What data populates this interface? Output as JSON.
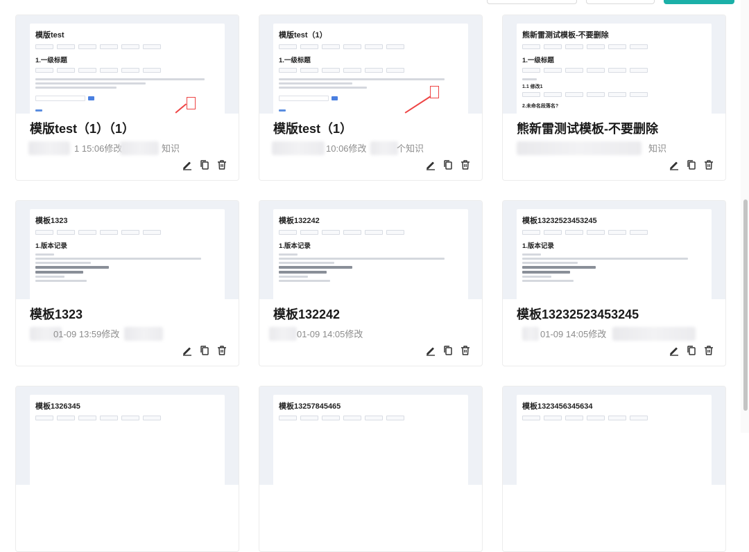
{
  "cards": [
    {
      "title": "模版test（1）（1）",
      "modified": "1 15:06修改",
      "kb": "知识",
      "preview": {
        "doc_title": "模版test",
        "heading": "1.一级标题",
        "subheading": ""
      }
    },
    {
      "title": "模版test（1）",
      "modified": "10:06修改",
      "kb": "个知识",
      "preview": {
        "doc_title": "模版test（1）",
        "heading": "1.一级标题",
        "subheading": ""
      }
    },
    {
      "title": "熊新雷测试模板-不要删除",
      "modified": "",
      "kb": "知识",
      "preview": {
        "doc_title": "熊新雷测试模板-不要删除",
        "heading": "1.一级标题",
        "subheading": "1.1 修改1",
        "subheading2": "2.未命名段落名?"
      }
    },
    {
      "title": "模板1323",
      "modified": "01-09 13:59修改",
      "kb": "",
      "preview": {
        "doc_title": "模板1323",
        "heading": "1.版本记录",
        "subheading": ""
      }
    },
    {
      "title": "模板132242",
      "modified": "01-09 14:05修改",
      "kb": "",
      "preview": {
        "doc_title": "模板132242",
        "heading": "1.版本记录",
        "subheading": ""
      }
    },
    {
      "title": "模板13232523453245",
      "modified": "01-09 14:05修改",
      "kb": "",
      "preview": {
        "doc_title": "模板13232523453245",
        "heading": "1.版本记录",
        "subheading": ""
      }
    },
    {
      "title": "",
      "modified": "",
      "kb": "",
      "preview": {
        "doc_title": "模板1326345",
        "heading": "",
        "subheading": ""
      }
    },
    {
      "title": "",
      "modified": "",
      "kb": "",
      "preview": {
        "doc_title": "模板13257845465",
        "heading": "",
        "subheading": ""
      }
    },
    {
      "title": "",
      "modified": "",
      "kb": "",
      "preview": {
        "doc_title": "模板1323456345634",
        "heading": "",
        "subheading": ""
      }
    }
  ],
  "icons": {
    "edit": "pencil-icon",
    "copy": "copy-icon",
    "delete": "trash-icon"
  },
  "colors": {
    "accent": "#1bb0a8",
    "annotation": "#e44444"
  }
}
